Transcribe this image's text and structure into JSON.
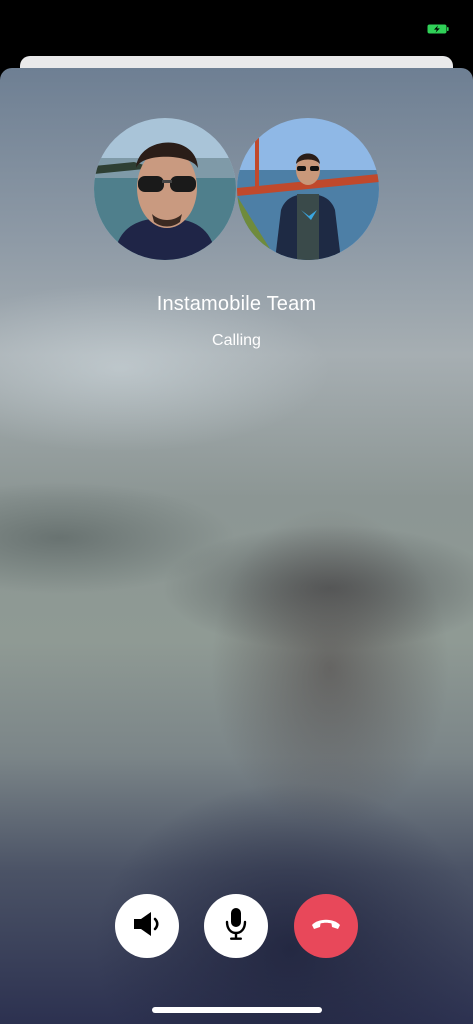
{
  "status_bar": {
    "battery_icon": "battery-charging-icon",
    "battery_color": "#30d158"
  },
  "call": {
    "participants": [
      {
        "avatar_icon": "participant-avatar-1"
      },
      {
        "avatar_icon": "participant-avatar-2"
      }
    ],
    "caller_name": "Instamobile Team",
    "status": "Calling"
  },
  "controls": {
    "speaker_icon": "speaker-icon",
    "mute_icon": "microphone-icon",
    "end_call_icon": "end-call-icon",
    "end_call_color": "#e8485a"
  }
}
